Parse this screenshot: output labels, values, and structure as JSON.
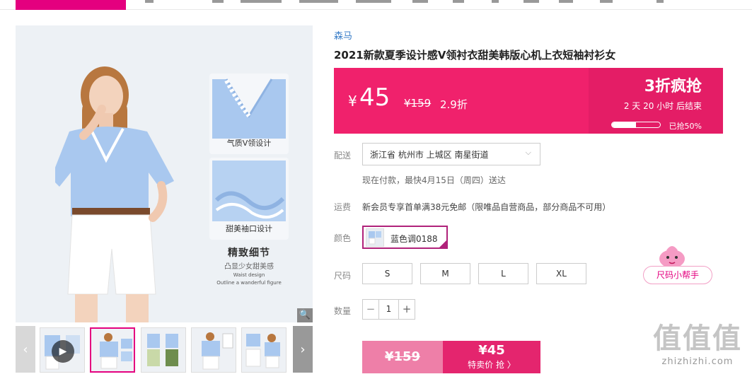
{
  "product": {
    "brand": "森马",
    "title": "2021新款夏季设计感V领衬衣甜美韩版心机上衣短袖衬衫女"
  },
  "gallery": {
    "detail_labels": [
      "气质V领设计",
      "甜美袖口设计"
    ],
    "detail_title": "精致细节",
    "detail_subtitle": "凸显少女甜美感",
    "detail_en_1": "Waist design",
    "detail_en_2": "Outline a wanderful figure",
    "zoom_icon": "🔍",
    "prev_icon": "‹",
    "next_icon": "›",
    "play_icon": "▶"
  },
  "price": {
    "currency": "¥",
    "current": "45",
    "original": "¥159",
    "discount": "2.9折",
    "flash_title": "3折疯抢",
    "countdown": "2 天 20 小时 后结束",
    "sold_label": "已抢50%",
    "sold_fraction": 0.5
  },
  "delivery": {
    "label": "配送",
    "address": "浙江省 杭州市 上城区 南星街道",
    "eta": "现在付款，最快4月15日（周四）送达"
  },
  "shipping": {
    "label": "运费",
    "text": "新会员专享首单满38元免邮（限唯品自营商品，部分商品不可用）"
  },
  "color": {
    "label": "颜色",
    "selected": "蓝色调0188"
  },
  "size": {
    "label": "尺码",
    "options": [
      "S",
      "M",
      "L",
      "XL"
    ],
    "helper": "尺码小帮手"
  },
  "quantity": {
    "label": "数量",
    "value": "1",
    "minus": "−",
    "plus": "+"
  },
  "buy": {
    "original": "¥159",
    "price": "¥45",
    "label": "特卖价 抢 〉"
  },
  "watermark": {
    "big": "值值值",
    "small": "zhizhizhi.com"
  },
  "colors": {
    "brand_pink": "#e4007f",
    "price_bg": "#f0216c",
    "brand_blue": "#3a7ec8"
  }
}
